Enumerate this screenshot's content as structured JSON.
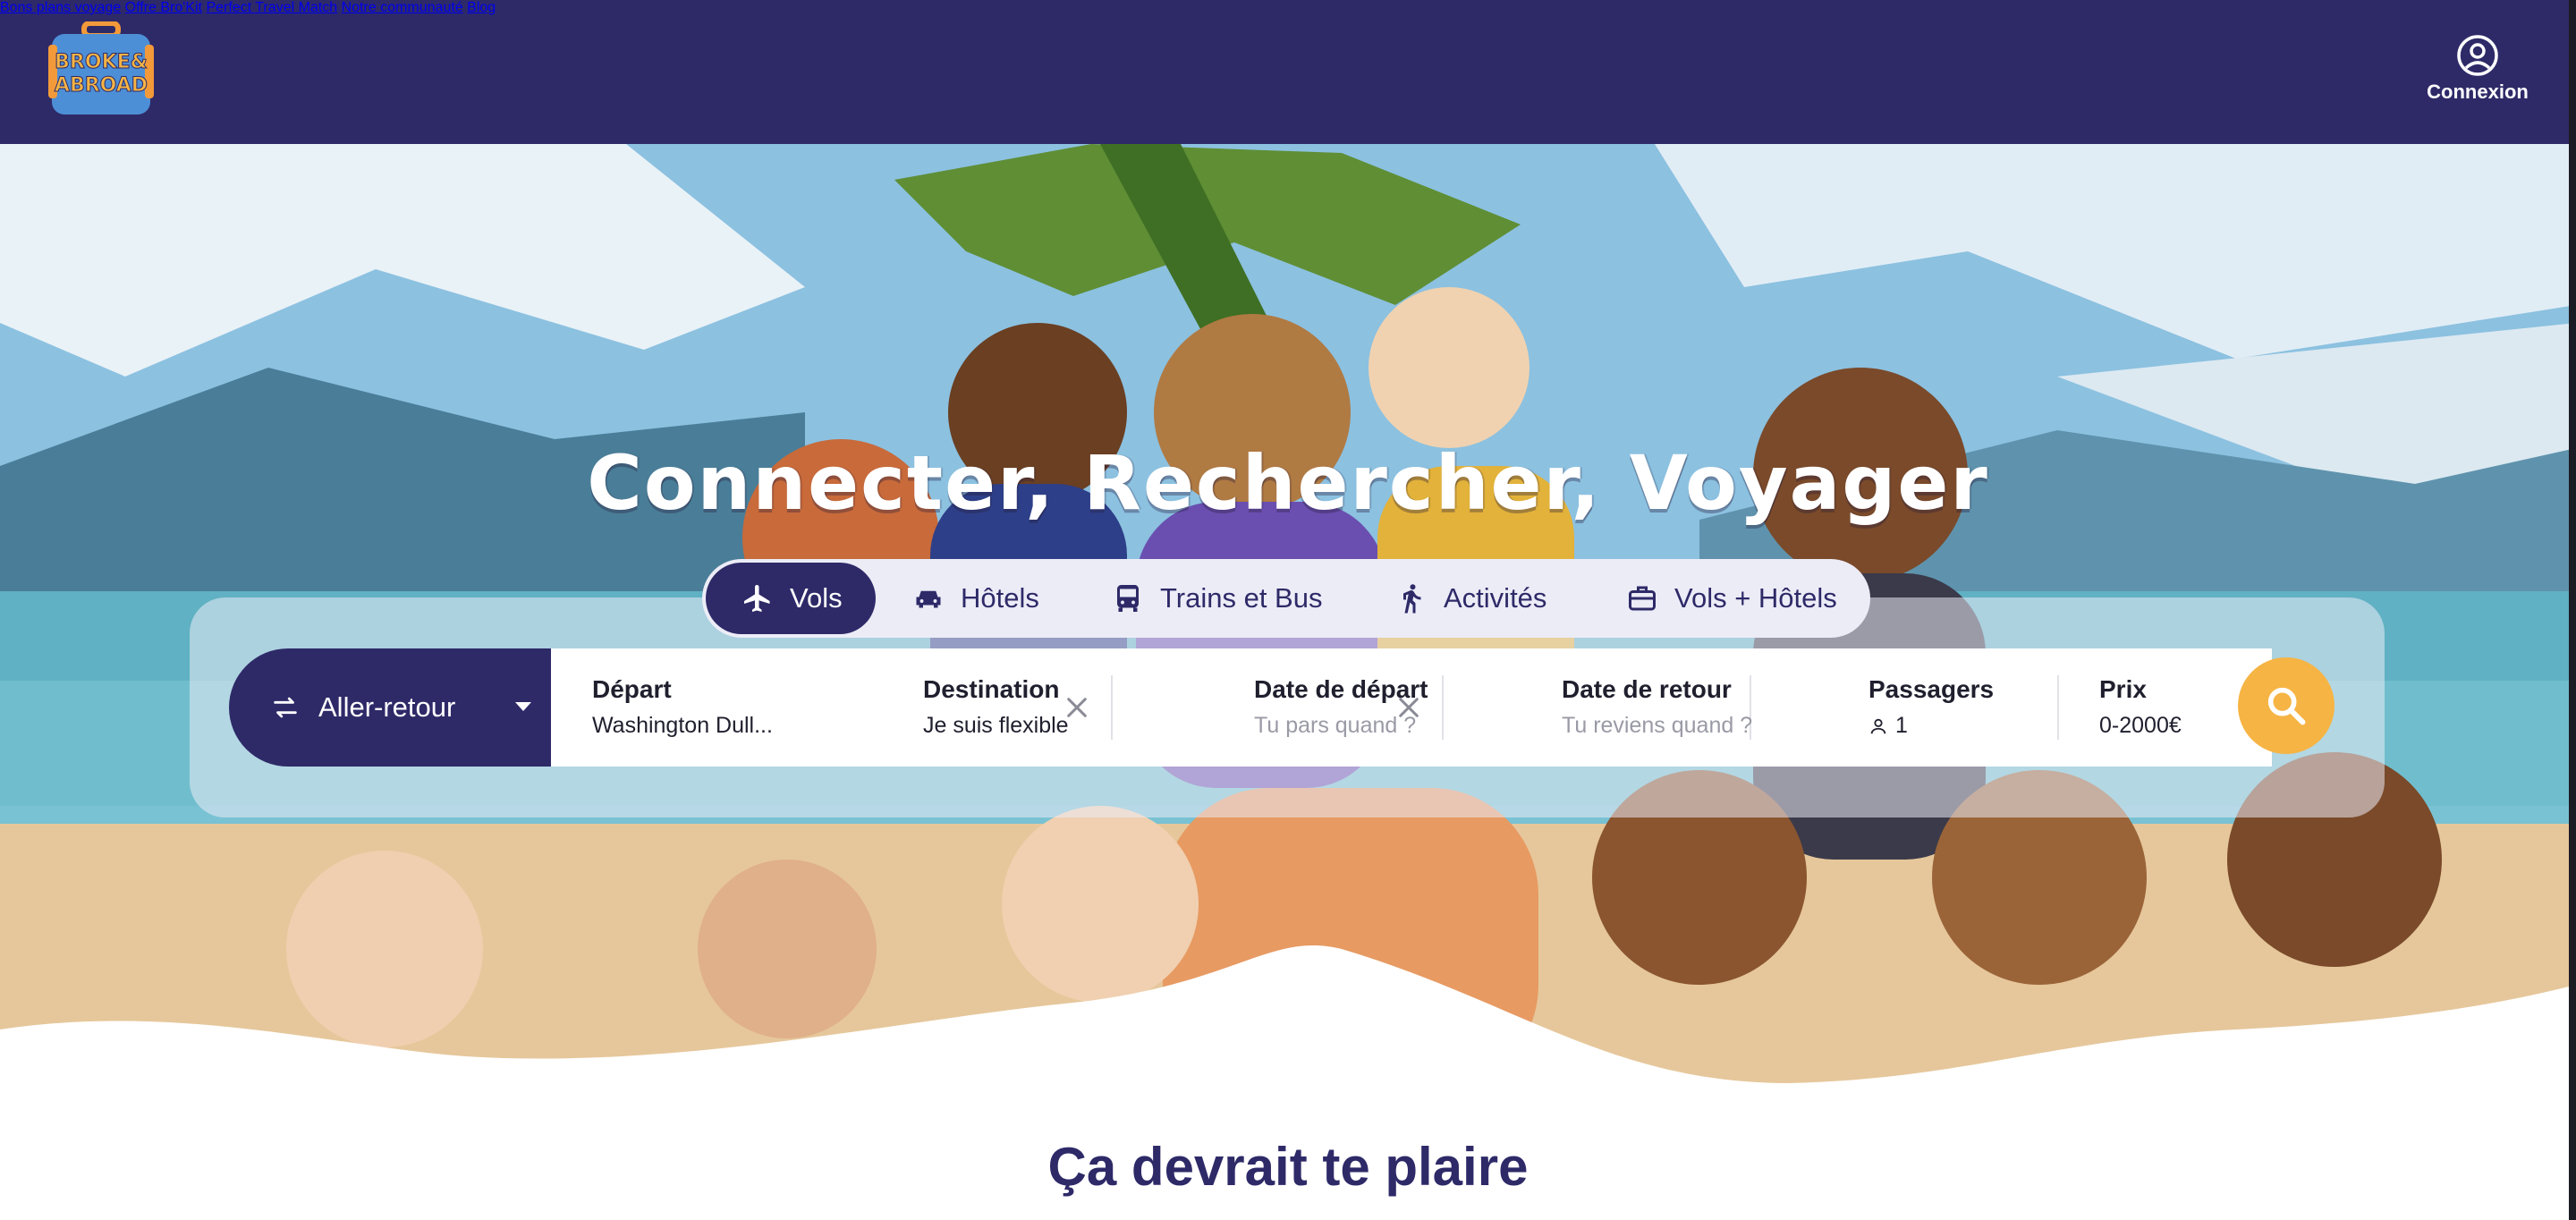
{
  "header": {
    "logo_text_line1": "BROKE&",
    "logo_text_line2": "ABROAD",
    "nav": [
      {
        "label": "Bons plans voyage"
      },
      {
        "label": "Offre Bro'Kit"
      },
      {
        "label": "Perfect Travel Match"
      },
      {
        "label": "Notre communauté"
      },
      {
        "label": "Blog"
      }
    ],
    "login_label": "Connexion"
  },
  "hero": {
    "title": "Connecter, Rechercher, Voyager"
  },
  "tabs": [
    {
      "label": "Vols",
      "icon": "plane-icon",
      "active": true
    },
    {
      "label": "Hôtels",
      "icon": "car-icon",
      "active": false
    },
    {
      "label": "Trains et Bus",
      "icon": "bus-icon",
      "active": false
    },
    {
      "label": "Activités",
      "icon": "hiker-icon",
      "active": false
    },
    {
      "label": "Vols + Hôtels",
      "icon": "suitcase-icon",
      "active": false
    }
  ],
  "search": {
    "trip_type": "Aller-retour",
    "depart": {
      "label": "Départ",
      "value": "Washington Dull..."
    },
    "destination": {
      "label": "Destination",
      "value": "Je suis flexible"
    },
    "date_depart": {
      "label": "Date de départ",
      "placeholder": "Tu pars quand ?"
    },
    "date_retour": {
      "label": "Date de retour",
      "placeholder": "Tu reviens quand ?"
    },
    "passagers": {
      "label": "Passagers",
      "value": "1"
    },
    "prix": {
      "label": "Prix",
      "value": "0-2000€"
    }
  },
  "section": {
    "title": "Ça devrait te plaire"
  },
  "colors": {
    "brand_navy": "#2e2a68",
    "accent_orange": "#f6b444",
    "tab_bg": "#ececf7"
  }
}
